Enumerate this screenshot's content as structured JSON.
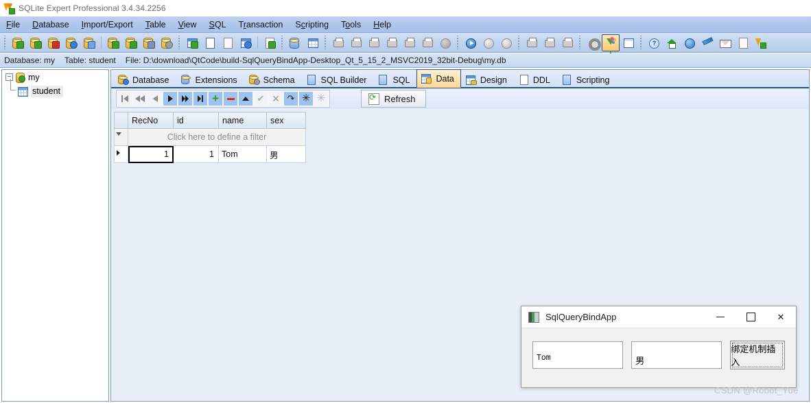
{
  "window": {
    "title": "SQLite Expert Professional 3.4.34.2256",
    "icon": "sqlite-expert-icon"
  },
  "menubar": {
    "items": [
      {
        "label": "File",
        "accel": "F"
      },
      {
        "label": "Database",
        "accel": "D"
      },
      {
        "label": "Import/Export",
        "accel": "I"
      },
      {
        "label": "Table",
        "accel": "T"
      },
      {
        "label": "View",
        "accel": "V"
      },
      {
        "label": "SQL",
        "accel": "S"
      },
      {
        "label": "Transaction",
        "accel": "r"
      },
      {
        "label": "Scripting",
        "accel": "c"
      },
      {
        "label": "Tools",
        "accel": "o"
      },
      {
        "label": "Help",
        "accel": "H"
      }
    ]
  },
  "toolbar": {
    "groups": [
      {
        "name": "database-group",
        "buttons": [
          {
            "name": "new-database",
            "icon": "database-new-icon"
          },
          {
            "name": "add-database",
            "icon": "database-add-icon"
          },
          {
            "name": "remove-database",
            "icon": "database-remove-icon"
          },
          {
            "name": "database-properties",
            "icon": "database-properties-icon"
          },
          {
            "name": "database-security",
            "icon": "database-lock-icon"
          },
          {
            "name": "refresh-database",
            "icon": "database-refresh-icon"
          },
          {
            "name": "verify-database",
            "icon": "database-check-icon"
          },
          {
            "name": "compact-database",
            "icon": "database-compact-icon"
          },
          {
            "name": "database-key",
            "icon": "database-key-icon"
          }
        ]
      },
      {
        "name": "table-group",
        "buttons": [
          {
            "name": "new-table",
            "icon": "table-new-icon"
          },
          {
            "name": "rename-object",
            "icon": "rename-text-icon"
          },
          {
            "name": "refresh-object",
            "icon": "refresh-page-icon"
          },
          {
            "name": "table-design",
            "icon": "table-design-icon"
          },
          {
            "name": "table-data-link",
            "icon": "table-link-icon"
          }
        ]
      },
      {
        "name": "sync-group",
        "buttons": [
          {
            "name": "compare-sync",
            "icon": "sync-arrows-icon"
          },
          {
            "name": "calendar-grid",
            "icon": "calendar-grid-icon"
          }
        ]
      },
      {
        "name": "import-group",
        "buttons": [
          {
            "name": "import-1",
            "icon": "import-icon"
          },
          {
            "name": "import-2",
            "icon": "import-text-icon"
          },
          {
            "name": "import-3",
            "icon": "import-db-icon"
          },
          {
            "name": "export-1",
            "icon": "export-icon"
          },
          {
            "name": "export-2",
            "icon": "export-save-icon"
          },
          {
            "name": "export-3",
            "icon": "export-doc-icon"
          },
          {
            "name": "cancel-operation",
            "icon": "cancel-circle-icon"
          }
        ]
      },
      {
        "name": "execute-group",
        "buttons": [
          {
            "name": "execute-sql",
            "icon": "play-icon"
          },
          {
            "name": "commit",
            "icon": "commit-circle-icon"
          },
          {
            "name": "rollback",
            "icon": "rollback-circle-icon"
          }
        ]
      },
      {
        "name": "script-group",
        "buttons": [
          {
            "name": "run-script",
            "icon": "script-run-icon"
          },
          {
            "name": "load-script",
            "icon": "script-load-icon"
          },
          {
            "name": "save-script",
            "icon": "script-save-icon"
          }
        ]
      },
      {
        "name": "options-group",
        "buttons": [
          {
            "name": "options",
            "icon": "gear-icon"
          },
          {
            "name": "filter-toggle",
            "icon": "funnel-icon",
            "selected": true
          },
          {
            "name": "grid-view",
            "icon": "grid-icon"
          }
        ]
      },
      {
        "name": "help-group",
        "buttons": [
          {
            "name": "help",
            "icon": "help-icon"
          },
          {
            "name": "home-page",
            "icon": "home-icon"
          },
          {
            "name": "web-support",
            "icon": "globe-icon"
          },
          {
            "name": "feedback",
            "icon": "pen-icon"
          },
          {
            "name": "email-support",
            "icon": "mail-icon"
          },
          {
            "name": "about-doc",
            "icon": "doc-help-icon"
          },
          {
            "name": "about",
            "icon": "about-logo-icon"
          }
        ]
      }
    ]
  },
  "infobar": {
    "database_label": "Database: my",
    "table_label": "Table: student",
    "file_label": "File: D:\\download\\QtCode\\build-SqlQueryBindApp-Desktop_Qt_5_15_2_MSVC2019_32bit-Debug\\my.db"
  },
  "tree": {
    "root": {
      "label": "my",
      "expander": "−",
      "icon": "database-connected-icon"
    },
    "children": [
      {
        "label": "student",
        "icon": "table-icon",
        "selected": true
      }
    ]
  },
  "tabs": [
    {
      "label": "Database",
      "icon": "database-icon",
      "active": false
    },
    {
      "label": "Extensions",
      "icon": "extensions-icon",
      "active": false
    },
    {
      "label": "Schema",
      "icon": "schema-icon",
      "active": false
    },
    {
      "label": "SQL Builder",
      "icon": "sql-builder-icon",
      "active": false
    },
    {
      "label": "SQL",
      "icon": "sql-icon",
      "active": false
    },
    {
      "label": "Data",
      "icon": "data-grid-icon",
      "active": true
    },
    {
      "label": "Design",
      "icon": "design-icon",
      "active": false
    },
    {
      "label": "DDL",
      "icon": "ddl-icon",
      "active": false
    },
    {
      "label": "Scripting",
      "icon": "scripting-icon",
      "active": false
    }
  ],
  "datanav": {
    "buttons": [
      {
        "name": "first-record",
        "icon": "first-icon",
        "state": "disabled"
      },
      {
        "name": "prior-page",
        "icon": "prior-page-icon",
        "state": "disabled"
      },
      {
        "name": "prior-record",
        "icon": "prior-icon",
        "state": "disabled"
      },
      {
        "name": "next-record",
        "icon": "next-icon",
        "state": "enabled"
      },
      {
        "name": "next-page",
        "icon": "next-page-icon",
        "state": "enabled"
      },
      {
        "name": "last-record",
        "icon": "last-icon",
        "state": "enabled"
      },
      {
        "name": "insert-record",
        "icon": "plus-icon",
        "state": "enabled"
      },
      {
        "name": "delete-record",
        "icon": "minus-icon",
        "state": "enabled"
      },
      {
        "name": "edit-record",
        "icon": "edit-up-icon",
        "state": "enabled"
      },
      {
        "name": "post-edit",
        "icon": "check-icon",
        "state": "disabled"
      },
      {
        "name": "cancel-edit",
        "icon": "cancel-x-icon",
        "state": "disabled"
      },
      {
        "name": "refresh-record",
        "icon": "redo-icon",
        "state": "enabled"
      },
      {
        "name": "set-null",
        "icon": "asterisk-icon",
        "state": "enabled"
      },
      {
        "name": "clear-null",
        "icon": "asterisk-dim-icon",
        "state": "disabled"
      }
    ],
    "refresh_label": "Refresh",
    "refresh_icon": "refresh-icon"
  },
  "grid": {
    "columns": [
      "RecNo",
      "id",
      "name",
      "sex"
    ],
    "filter_placeholder": "Click here to define a filter",
    "rows": [
      {
        "RecNo": "1",
        "id": "1",
        "name": "Tom",
        "sex": "男",
        "current": true
      }
    ]
  },
  "dialog": {
    "title": "SqlQueryBindApp",
    "icon": "qt-app-icon",
    "controls": {
      "minimize": "—",
      "maximize": "□",
      "close": "✕"
    },
    "name_input": {
      "value": "Tom",
      "name": "name-input"
    },
    "sex_input": {
      "value": "男",
      "name": "sex-input"
    },
    "submit_button": {
      "label": "绑定机制插入",
      "name": "bind-insert-button"
    }
  },
  "watermark": "CSDN @Robot_Yue",
  "colors": {
    "menubar_blue": "#aec7ec",
    "toolbar_blue": "#c3d6f0",
    "tab_active": "#fbd99b",
    "tab_border": "#2b4f87",
    "nav_blue": "#9ec3ee",
    "accent_green": "#2f9a2a",
    "accent_red": "#cf3023"
  }
}
